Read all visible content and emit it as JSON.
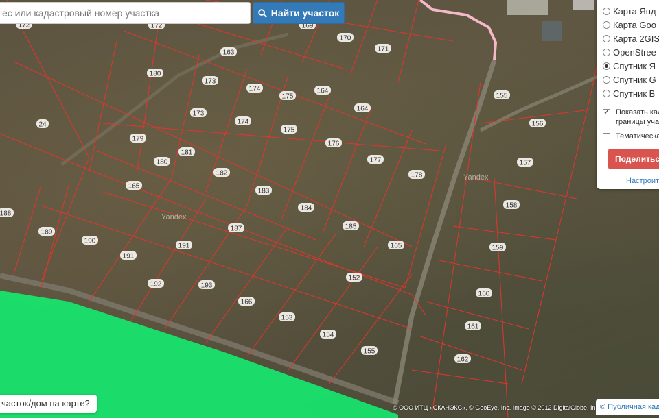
{
  "search": {
    "placeholder": "ес или кадастровый номер участка",
    "button_label": "Найти участок"
  },
  "layers": {
    "options": [
      {
        "label": "Карта Янд",
        "selected": false
      },
      {
        "label": "Карта Goo",
        "selected": false
      },
      {
        "label": "Карта 2GIS",
        "selected": false
      },
      {
        "label": "OpenStree",
        "selected": false
      },
      {
        "label": "Спутник Я",
        "selected": true
      },
      {
        "label": "Спутник G",
        "selected": false
      },
      {
        "label": "Спутник B",
        "selected": false
      }
    ],
    "show_borders_line1": "Показать кад",
    "show_borders_line2": "границы уча",
    "thematic_label": "Тематическа",
    "share_label": "Поделиться",
    "settings_label": "Настроит"
  },
  "map": {
    "yandex_watermark": "Yandex",
    "parcel_labels": [
      "24",
      "172",
      "172",
      "163",
      "169",
      "170",
      "171",
      "173",
      "174",
      "175",
      "164",
      "164",
      "173",
      "174",
      "175",
      "176",
      "177",
      "178",
      "179",
      "180",
      "180",
      "181",
      "182",
      "183",
      "184",
      "185",
      "165",
      "165",
      "187",
      "188",
      "189",
      "190",
      "191",
      "191",
      "192",
      "193",
      "166",
      "152",
      "153",
      "154",
      "155",
      "155",
      "156",
      "157",
      "158",
      "159",
      "160",
      "161",
      "162"
    ],
    "locate_hint": "частoк/дом на карте?",
    "attribution": "© ООО ИТЦ «СКАНЭКС», © GeoEye, Inc. Image © 2012 DigitalGlobe, Inc.",
    "public_map_label": "© Публичная кад"
  },
  "colors": {
    "parcel_line": "#e3342f",
    "green_zone": "#17e66e",
    "road_pink": "#f5b8c8",
    "search_button": "#337ab7",
    "share_button": "#d9534f"
  }
}
